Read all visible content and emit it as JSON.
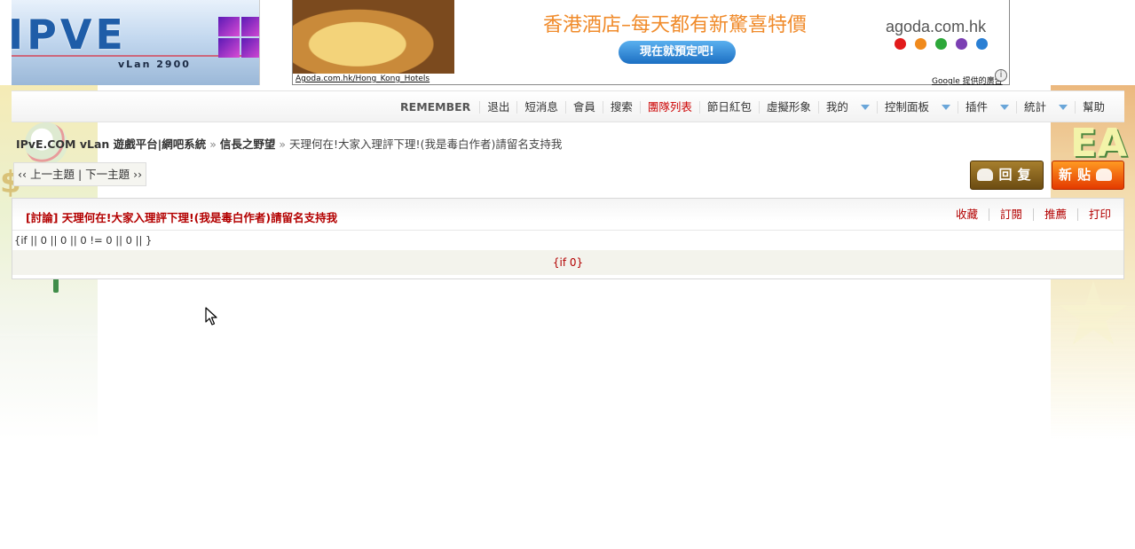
{
  "header": {
    "logo_text": "IPVE",
    "logo_sub": "vLan 2900"
  },
  "ad": {
    "headline": "香港酒店–每天都有新驚喜特價",
    "cta": "現在就預定吧!",
    "brand": "agoda.com.hk",
    "dot_colors": [
      "#e21b1b",
      "#f08a1c",
      "#2da83a",
      "#7b3fb3",
      "#2a7fd4"
    ],
    "url_text": "Agoda.com.hk/Hong_Kong_Hotels",
    "provider": "Google 提供的廣告",
    "info_icon": "i"
  },
  "nav": {
    "username": "REMEMBER",
    "items": [
      {
        "label": "退出"
      },
      {
        "label": "短消息"
      },
      {
        "label": "會員"
      },
      {
        "label": "搜索"
      },
      {
        "label": "團隊列表"
      },
      {
        "label": "節日紅包"
      },
      {
        "label": "虛擬形象"
      },
      {
        "label": "我的"
      },
      {
        "label": "控制面板"
      },
      {
        "label": "插件"
      },
      {
        "label": "統計"
      },
      {
        "label": "幫助"
      }
    ]
  },
  "breadcrumb": {
    "site": "IPvE.COM vLan 遊戲平台|網吧系統",
    "forum": "信長之野望",
    "topic": "天理何在!大家入理評下理!(我是毒白作者)請留名支持我",
    "sep": "»"
  },
  "pager": {
    "prev": "‹‹ 上一主題",
    "divider": "|",
    "next": "下一主題 ››"
  },
  "buttons": {
    "reply": "回复",
    "new_post": "新贴"
  },
  "thread": {
    "title": "[討論] 天理何在!大家入理評下理!(我是毒白作者)請留名支持我",
    "actions": [
      "收藏",
      "訂閱",
      "推薦",
      "打印"
    ],
    "code_line": "{if || 0 || 0 || 0 != 0 || 0 || }",
    "row_text": "{if 0}"
  },
  "colors": {
    "accent_red": "#b30000",
    "reply_button": "#8a6420",
    "new_button": "#f06a10"
  }
}
